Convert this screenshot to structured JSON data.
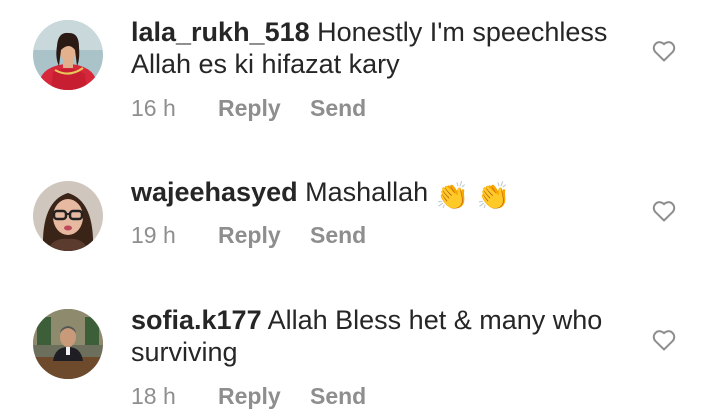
{
  "comments": [
    {
      "username": "lala_rukh_518",
      "text": "Honestly I'm speechless Allah es ki hifazat kary",
      "time": "16 h",
      "reply_label": "Reply",
      "send_label": "Send"
    },
    {
      "username": "wajeehasyed",
      "text": "Mashallah",
      "emoji": [
        "👏",
        "👏"
      ],
      "time": "19 h",
      "reply_label": "Reply",
      "send_label": "Send"
    },
    {
      "username": "sofia.k177",
      "text": "Allah Bless het & many who surviving",
      "time": "18 h",
      "reply_label": "Reply",
      "send_label": "Send"
    }
  ],
  "icons": {
    "like": "heart-outline-icon"
  },
  "colors": {
    "text": "#262626",
    "meta": "#8e8e8e",
    "background": "#ffffff"
  }
}
